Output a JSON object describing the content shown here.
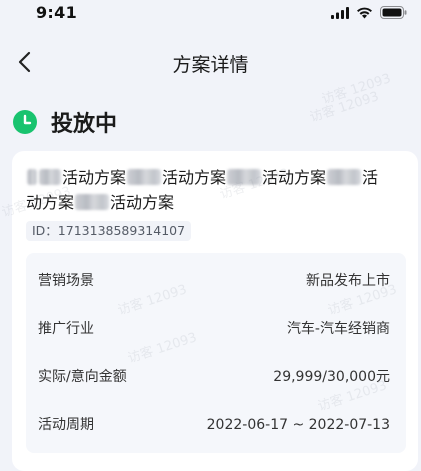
{
  "status_bar": {
    "time": "9:41"
  },
  "nav": {
    "title": "方案详情"
  },
  "plan_status": {
    "text": "投放中",
    "color": "#19c36f"
  },
  "plan": {
    "name_segments": [
      "活动方案",
      "活动方案",
      "活动方案",
      "活",
      "动方案",
      "活动方案"
    ],
    "id": "ID：1713138589314107"
  },
  "details": [
    {
      "label": "营销场景",
      "value": "新品发布上市"
    },
    {
      "label": "推广行业",
      "value": "汽车-汽车经销商"
    },
    {
      "label": "实际/意向金额",
      "value": "29,999/30,000元"
    },
    {
      "label": "活动周期",
      "value": "2022-06-17 ~ 2022-07-13"
    }
  ],
  "watermark": {
    "line1": "访客 12093",
    "line2": "访客 12093"
  }
}
